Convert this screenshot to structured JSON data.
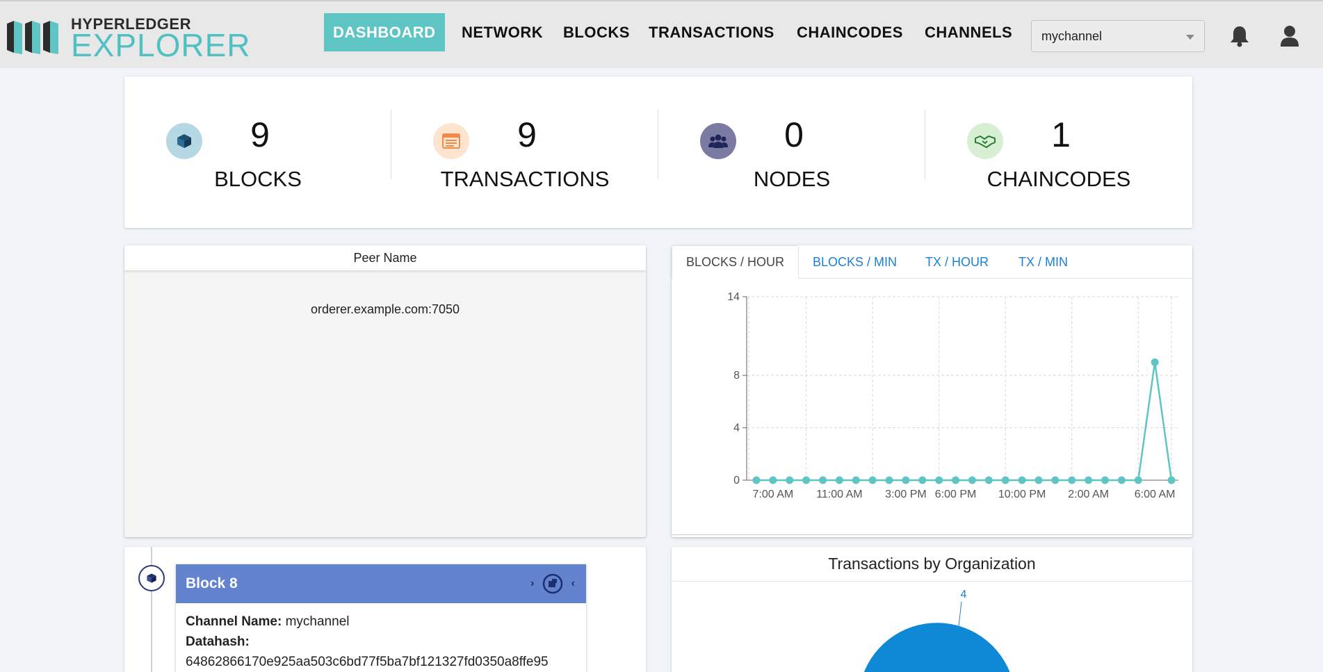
{
  "brand": {
    "top": "HYPERLEDGER",
    "bottom": "EXPLORER"
  },
  "nav": {
    "dashboard": "DASHBOARD",
    "network": "NETWORK",
    "blocks": "BLOCKS",
    "transactions": "TRANSACTIONS",
    "chaincodes": "CHAINCODES",
    "channels": "CHANNELS",
    "channel_selected": "mychannel",
    "bell_icon": "bell-icon",
    "user_icon": "user-icon"
  },
  "stats": [
    {
      "value": "9",
      "label": "BLOCKS",
      "icon": "cube-icon",
      "color": "#b6d7e4"
    },
    {
      "value": "9",
      "label": "TRANSACTIONS",
      "icon": "list-icon",
      "color": "#fde4cf"
    },
    {
      "value": "0",
      "label": "NODES",
      "icon": "users-icon",
      "color": "#7a7aa2"
    },
    {
      "value": "1",
      "label": "CHAINCODES",
      "icon": "handshake-icon",
      "color": "#d7f0d4"
    }
  ],
  "peers": {
    "header": "Peer Name",
    "rows": [
      "orderer.example.com:7050"
    ]
  },
  "chart_tabs": [
    "BLOCKS / HOUR",
    "BLOCKS / MIN",
    "TX / HOUR",
    "TX / MIN"
  ],
  "chart_data": {
    "type": "line",
    "x_ticks": [
      "7:00 AM",
      "11:00 AM",
      "3:00 PM",
      "6:00 PM",
      "10:00 PM",
      "2:00 AM",
      "6:00 AM"
    ],
    "y_ticks": [
      0,
      4,
      8,
      14
    ],
    "ylim": [
      0,
      14
    ],
    "grid": true,
    "color": "#5ec5c4",
    "values": [
      0,
      0,
      0,
      0,
      0,
      0,
      0,
      0,
      0,
      0,
      0,
      0,
      0,
      0,
      0,
      0,
      0,
      0,
      0,
      0,
      0,
      0,
      0,
      0,
      9,
      0
    ]
  },
  "timeline": {
    "block_title": "Block 8",
    "channel_label": "Channel Name:",
    "channel_value": "mychannel",
    "datahash_label": "Datahash:",
    "datahash_value": "64862866170e925aa503c6bd77f5ba7bf121327fd0350a8ffe95"
  },
  "org": {
    "title": "Transactions by Organization",
    "pie_label": "4",
    "colors": [
      "#0f88d6",
      "#5b3ab0"
    ]
  }
}
